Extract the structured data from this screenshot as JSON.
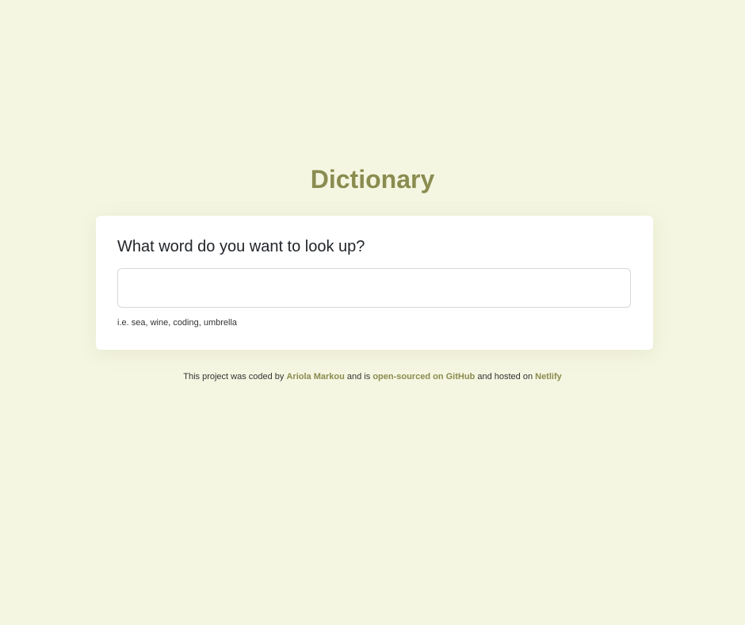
{
  "app": {
    "title": "Dictionary"
  },
  "search": {
    "question": "What word do you want to look up?",
    "value": "",
    "placeholder": "",
    "hint": "i.e. sea, wine, coding, umbrella"
  },
  "footer": {
    "text_1": "This project was coded by",
    "author_link": "Ariola Markou",
    "text_2": "and is",
    "github_link": "open-sourced on GitHub",
    "text_3": "and hosted on",
    "host_link": "Netlify"
  },
  "colors": {
    "background": "#f5f6e1",
    "accent": "#8a8c50",
    "card": "#ffffff",
    "text": "#212529"
  }
}
